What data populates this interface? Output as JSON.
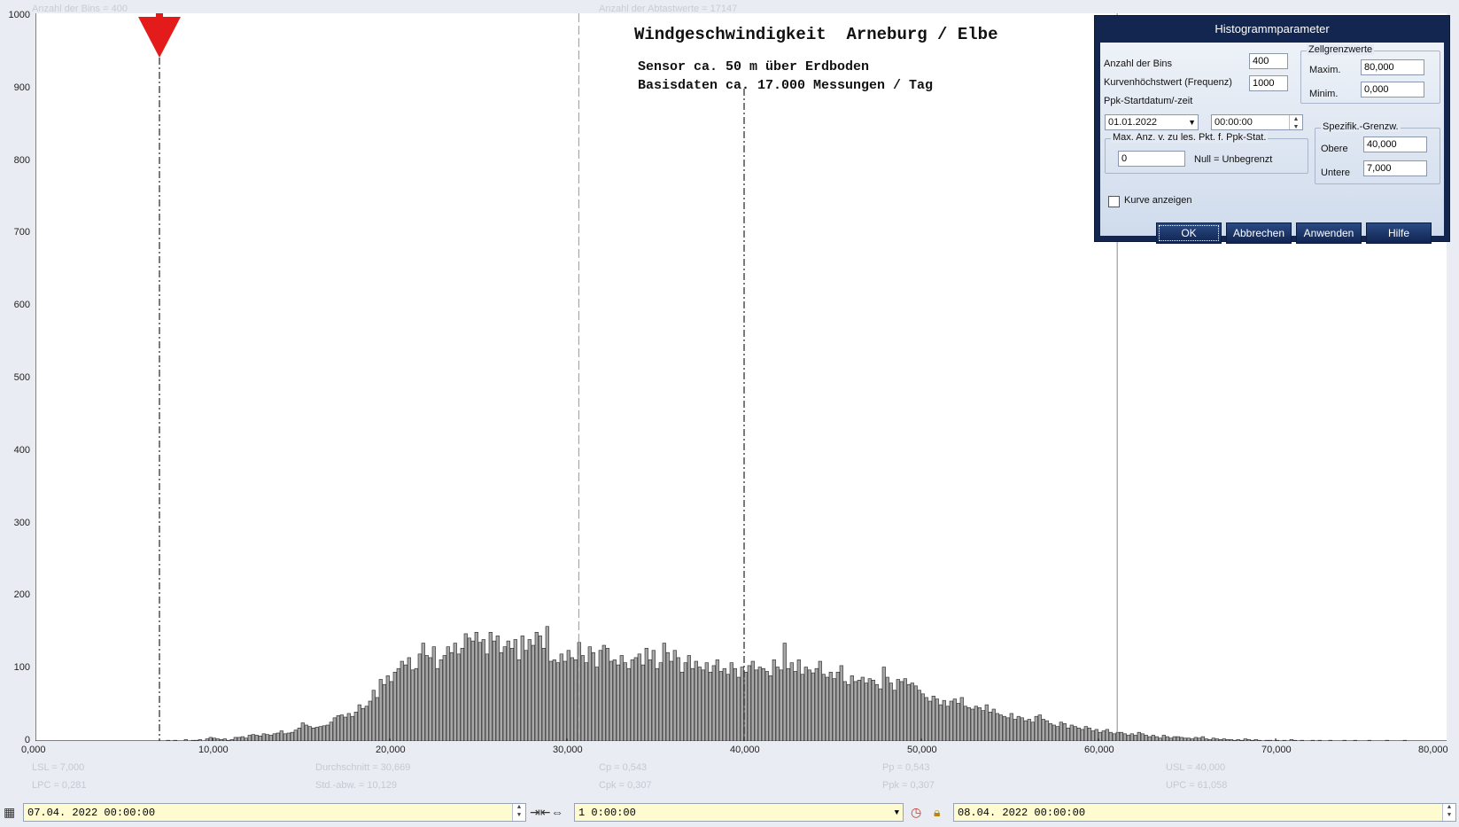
{
  "header": {
    "bins_info": "Anzahl der Bins =   400",
    "samples_info": "Anzahl der Abtastwerte = 17147"
  },
  "chart_data": {
    "type": "bar",
    "title": "Windgeschwindigkeit  Arneburg / Elbe",
    "subtitle_lines": [
      "Sensor ca. 50 m über Erdboden",
      "Basisdaten ca. 17.000 Messungen / Tag"
    ],
    "xlim": [
      0,
      80
    ],
    "ylim": [
      0,
      1000
    ],
    "x_tick_labels": [
      "0,000",
      "10,000",
      "20,000",
      "30,000",
      "40,000",
      "50,000",
      "60,000",
      "70,000",
      "80,000"
    ],
    "y_tick_labels": [
      "1000",
      "900",
      "800",
      "700",
      "600",
      "500",
      "400",
      "300",
      "200",
      "100",
      "0"
    ],
    "bin_width": 0.2,
    "bin_start": 7.4,
    "values": [
      1,
      0,
      1,
      0,
      0,
      2,
      0,
      1,
      1,
      2,
      0,
      3,
      5,
      4,
      3,
      2,
      3,
      1,
      2,
      5,
      5,
      6,
      4,
      8,
      9,
      8,
      7,
      10,
      9,
      8,
      10,
      11,
      14,
      10,
      11,
      12,
      15,
      18,
      25,
      22,
      20,
      18,
      19,
      20,
      21,
      22,
      26,
      32,
      35,
      36,
      33,
      38,
      34,
      40,
      50,
      45,
      48,
      55,
      70,
      60,
      85,
      78,
      90,
      82,
      95,
      100,
      110,
      105,
      115,
      98,
      100,
      120,
      135,
      118,
      115,
      130,
      100,
      112,
      118,
      130,
      122,
      135,
      120,
      128,
      148,
      142,
      138,
      150,
      136,
      140,
      120,
      150,
      138,
      145,
      122,
      130,
      138,
      128,
      140,
      112,
      145,
      125,
      140,
      132,
      150,
      145,
      128,
      158,
      110,
      112,
      108,
      120,
      110,
      125,
      115,
      112,
      136,
      118,
      108,
      130,
      122,
      102,
      125,
      132,
      128,
      110,
      112,
      105,
      118,
      108,
      100,
      112,
      115,
      120,
      105,
      128,
      112,
      125,
      100,
      108,
      135,
      122,
      110,
      125,
      115,
      95,
      108,
      118,
      100,
      110,
      102,
      98,
      108,
      95,
      104,
      112,
      96,
      100,
      92,
      108,
      100,
      88,
      102,
      95,
      104,
      110,
      98,
      102,
      100,
      96,
      90,
      112,
      102,
      98,
      135,
      100,
      108,
      96,
      112,
      92,
      102,
      98,
      94,
      100,
      110,
      92,
      88,
      95,
      86,
      95,
      104,
      82,
      78,
      90,
      82,
      84,
      88,
      80,
      86,
      84,
      78,
      72,
      102,
      88,
      80,
      70,
      85,
      82,
      86,
      78,
      80,
      76,
      70,
      65,
      60,
      55,
      62,
      58,
      50,
      56,
      48,
      55,
      58,
      52,
      60,
      48,
      46,
      44,
      48,
      46,
      42,
      50,
      40,
      44,
      38,
      36,
      34,
      32,
      38,
      30,
      34,
      32,
      28,
      30,
      26,
      34,
      36,
      30,
      28,
      24,
      22,
      20,
      26,
      24,
      18,
      22,
      20,
      18,
      16,
      20,
      18,
      14,
      16,
      12,
      14,
      16,
      12,
      10,
      12,
      12,
      10,
      8,
      10,
      8,
      12,
      10,
      8,
      6,
      8,
      6,
      4,
      8,
      6,
      4,
      6,
      6,
      5,
      4,
      4,
      3,
      5,
      4,
      6,
      3,
      2,
      4,
      3,
      2,
      3,
      2,
      2,
      1,
      2,
      1,
      3,
      2,
      1,
      2,
      1,
      0,
      1,
      1,
      0,
      1,
      0,
      1,
      0,
      2,
      1,
      0,
      1,
      0,
      0,
      1,
      0,
      1,
      0,
      0,
      1,
      0,
      0,
      0,
      1,
      0,
      0,
      1,
      0,
      0,
      0,
      1,
      0,
      0,
      0,
      0,
      1,
      0,
      0,
      0,
      0,
      1
    ],
    "lsl": 7.0,
    "mean": 30.669,
    "usl": 40.0,
    "upc": 61.058
  },
  "stats": {
    "lsl": "LSL = 7,000",
    "lpc": "LPC = 0,281",
    "mean": "Durchschnitt  = 30,669",
    "std": "Std.-abw.  = 10,129",
    "cp": "Cp  = 0,543",
    "cpk": "Cpk = 0,307",
    "pp": "Pp  = 0,543",
    "ppk": "Ppk = 0,307",
    "usl": "USL = 40,000",
    "upc": "UPC = 61,058"
  },
  "dialog": {
    "title": "Histogrammparameter",
    "bins_label": "Anzahl der Bins",
    "bins_value": "400",
    "curvemax_label": "Kurvenhöchstwert (Frequenz)",
    "curvemax_value": "1000",
    "ppk_start_label": "Ppk-Startdatum/-zeit",
    "start_date": "01.01.2022",
    "start_time": "00:00:00",
    "cell_group": "Zellgrenzwerte",
    "max_label": "Maxim.",
    "max_value": "80,000",
    "min_label": "Minim.",
    "min_value": "0,000",
    "maxpoints_group": "Max. Anz. v. zu les. Pkt. f. Ppk-Stat.",
    "maxpoints_value": "0",
    "null_hint": "Null = Unbegrenzt",
    "spec_group": "Spezifik.-Grenzw.",
    "upper_label": "Obere",
    "upper_value": "40,000",
    "lower_label": "Untere",
    "lower_value": "7,000",
    "show_curve_label": "Kurve anzeigen",
    "ok": "OK",
    "cancel": "Abbrechen",
    "apply": "Anwenden",
    "help": "Hilfe"
  },
  "bottom": {
    "start": "07.04. 2022   00:00:00",
    "interval": "1 0:00:00",
    "end": "08.04. 2022   00:00:00"
  }
}
